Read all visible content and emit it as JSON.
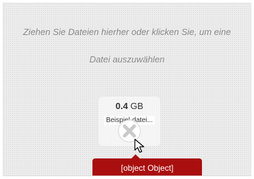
{
  "dropzone": {
    "message_line1": "Ziehen Sie Dateien hierher oder klicken Sie, um eine",
    "message_line2": "Datei auszuwählen"
  },
  "file": {
    "size_value": "0.4",
    "size_unit": "GB",
    "name": "Beispiel-datei..."
  },
  "error": {
    "message": "[object Object]",
    "color": "#a90f0f"
  },
  "icons": {
    "error_mark": "x-circle-icon",
    "cursor": "mouse-pointer-icon"
  }
}
